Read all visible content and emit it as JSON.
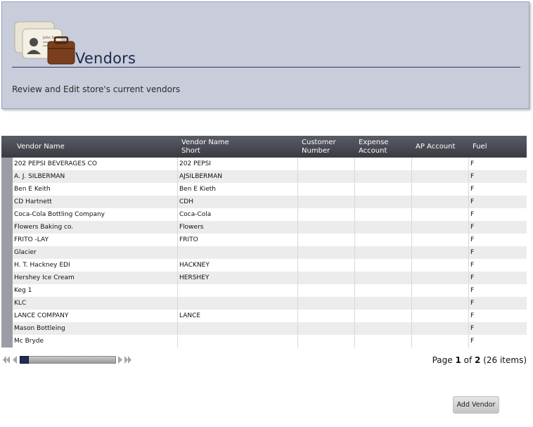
{
  "header": {
    "title": "Vendors",
    "description": "Review and Edit store's current vendors",
    "icon_card_text": "John Smith"
  },
  "grid": {
    "columns": [
      {
        "key": "vendor_name",
        "label": "Vendor Name"
      },
      {
        "key": "vendor_name_short",
        "label": "Vendor Name\nShort"
      },
      {
        "key": "customer_number",
        "label": "Customer\nNumber"
      },
      {
        "key": "expense_account",
        "label": "Expense\nAccount"
      },
      {
        "key": "ap_account",
        "label": "AP Account"
      },
      {
        "key": "fuel",
        "label": "Fuel"
      }
    ],
    "rows": [
      [
        "202 PEPSI BEVERAGES CO",
        "202 PEPSI",
        "",
        "",
        "",
        "F"
      ],
      [
        "A. J. SILBERMAN",
        "AJSILBERMAN",
        "",
        "",
        "",
        "F"
      ],
      [
        "Ben E Keith",
        "Ben E Kieth",
        "",
        "",
        "",
        "F"
      ],
      [
        "CD Hartnett",
        "CDH",
        "",
        "",
        "",
        "F"
      ],
      [
        "Coca-Cola Bottling Company",
        "Coca-Cola",
        "",
        "",
        "",
        "F"
      ],
      [
        "Flowers Baking co.",
        "Flowers",
        "",
        "",
        "",
        "F"
      ],
      [
        "FRITO -LAY",
        "FRITO",
        "",
        "",
        "",
        "F"
      ],
      [
        "Glacier",
        "",
        "",
        "",
        "",
        "F"
      ],
      [
        "H. T. Hackney EDI",
        "HACKNEY",
        "",
        "",
        "",
        "F"
      ],
      [
        "Hershey Ice Cream",
        "HERSHEY",
        "",
        "",
        "",
        "F"
      ],
      [
        "Keg 1",
        "",
        "",
        "",
        "",
        "F"
      ],
      [
        "KLC",
        "",
        "",
        "",
        "",
        "F"
      ],
      [
        "LANCE COMPANY",
        "LANCE",
        "",
        "",
        "",
        "F"
      ],
      [
        "Mason Bottleing",
        "",
        "",
        "",
        "",
        "F"
      ],
      [
        "Mc Bryde",
        "",
        "",
        "",
        "",
        "F"
      ]
    ]
  },
  "pager": {
    "prefix": "Page ",
    "current_page": "1",
    "of": " of ",
    "total_pages": "2",
    "items": " (26 items)"
  },
  "actions": {
    "add_vendor_label": "Add Vendor"
  },
  "colors": {
    "header_bg": "#c8ccdb",
    "title": "#1d2a4a",
    "grid_header": "#393b42",
    "row_alt": "#ececec"
  }
}
